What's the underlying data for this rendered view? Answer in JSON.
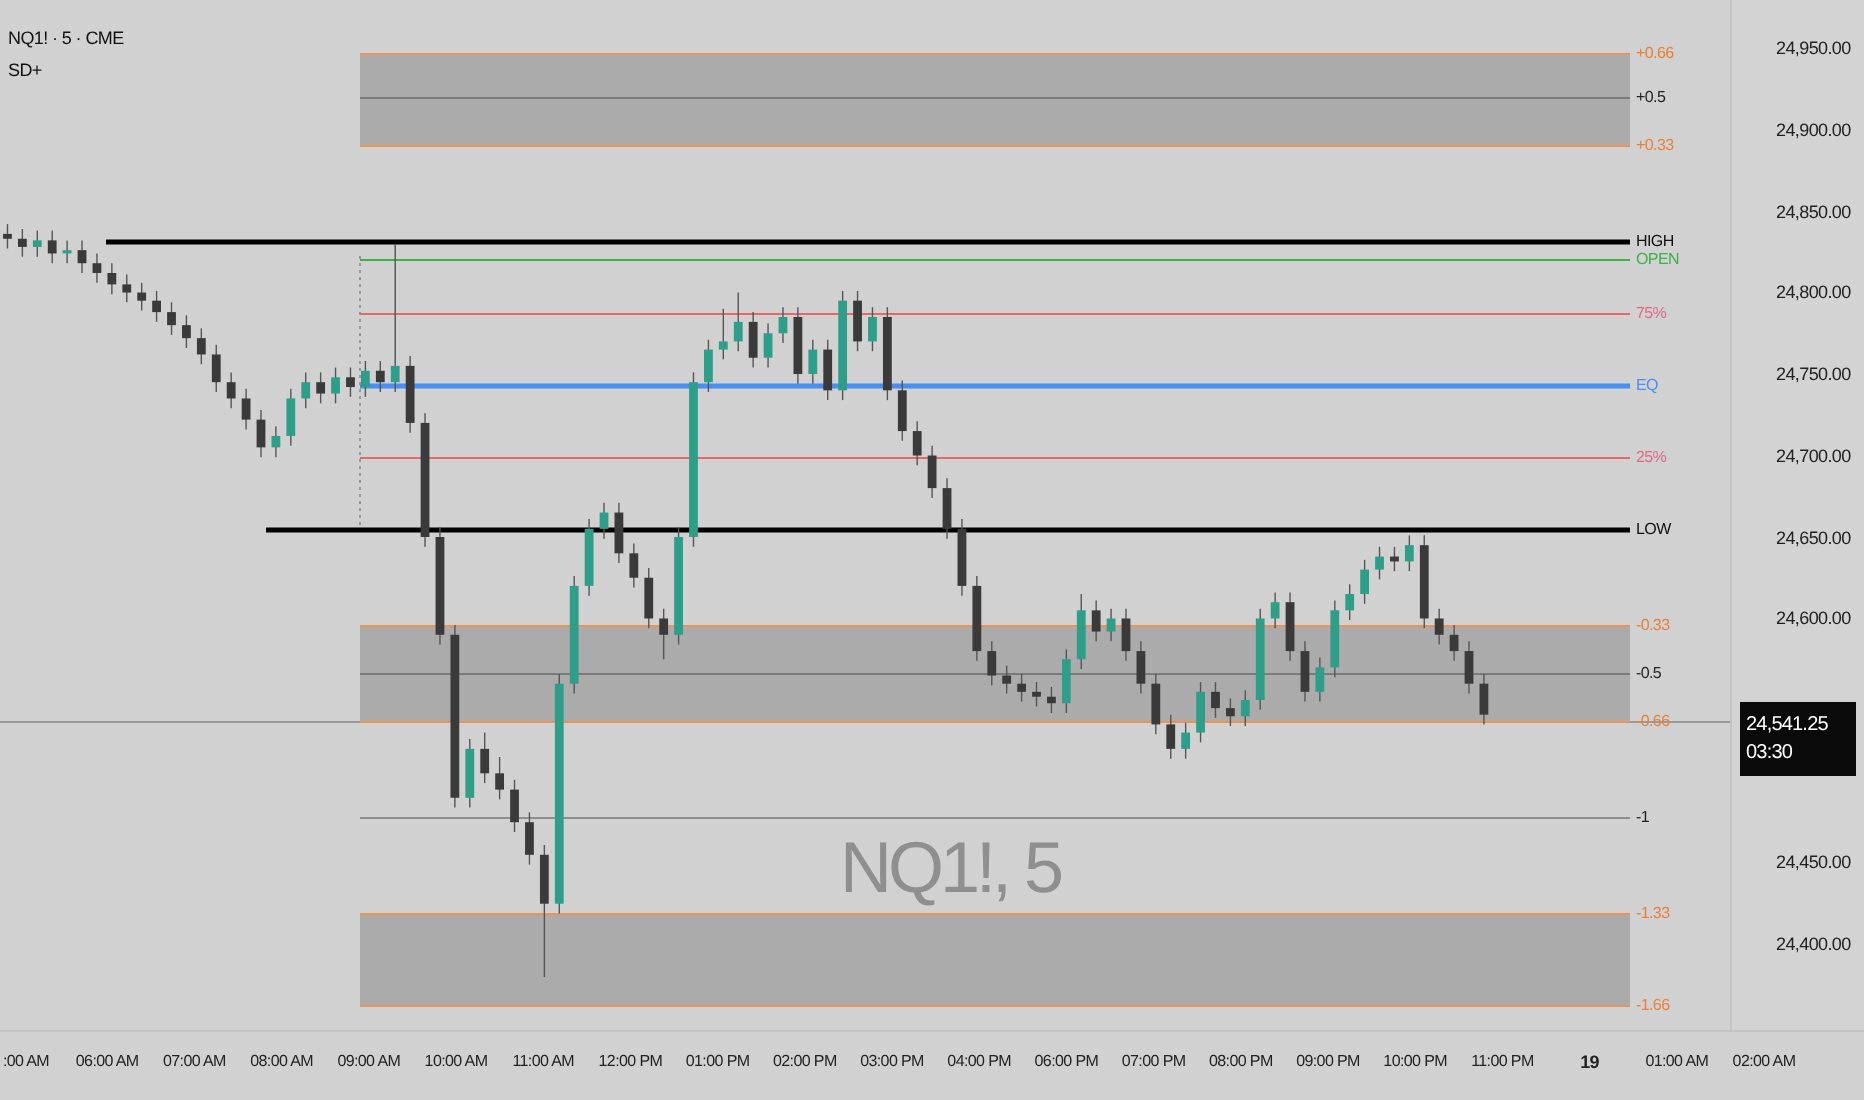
{
  "legend": {
    "symbol": "NQ1! · 5 · CME",
    "indicator": "SD+"
  },
  "symbol_watermark": "NQ1!, 5",
  "chart_data": {
    "type": "candlestick",
    "categories": [
      null,
      null,
      null,
      null,
      null,
      null,
      null,
      null,
      null,
      null,
      null,
      null,
      null,
      null,
      null,
      null,
      null,
      null,
      null,
      null,
      null,
      null,
      null,
      null,
      null,
      null,
      null,
      null,
      null,
      null,
      null,
      null,
      null,
      null,
      null,
      null,
      null,
      null,
      null,
      null,
      null,
      null,
      null,
      null,
      null,
      null,
      null,
      null,
      null,
      null,
      null,
      null,
      null,
      null,
      null,
      null,
      null,
      null,
      null,
      null,
      null,
      null,
      null,
      null,
      null,
      null,
      null,
      null,
      null,
      null,
      null,
      null,
      null,
      null,
      null,
      null,
      null,
      null,
      null,
      null,
      null,
      null,
      null,
      null,
      null,
      null,
      null,
      null,
      null,
      null,
      null,
      null,
      null,
      null,
      null,
      null,
      null,
      null,
      null,
      null,
      null,
      null,
      null,
      null,
      null,
      null,
      null,
      null,
      null,
      null,
      null,
      null,
      null,
      null,
      null,
      null
    ],
    "ylim": [
      24347.5,
      24979.5
    ],
    "yticks": [
      {
        "value": 24950,
        "label": "24,950.00"
      },
      {
        "value": 24900,
        "label": "24,900.00"
      },
      {
        "value": 24850,
        "label": "24,850.00"
      },
      {
        "value": 24800,
        "label": "24,800.00"
      },
      {
        "value": 24750,
        "label": "24,750.00"
      },
      {
        "value": 24700,
        "label": "24,700.00"
      },
      {
        "value": 24650,
        "label": "24,650.00"
      },
      {
        "value": 24600,
        "label": "24,600.00"
      },
      {
        "value": 24450,
        "label": "24,450.00"
      },
      {
        "value": 24400,
        "label": "24,400.00"
      }
    ],
    "ohlc": [
      [
        24836,
        24842,
        24827,
        24833
      ],
      [
        24833,
        24839,
        24822,
        24828
      ],
      [
        24828,
        24838,
        24822,
        24832
      ],
      [
        24832,
        24838,
        24818,
        24824
      ],
      [
        24824,
        24832,
        24818,
        24826
      ],
      [
        24826,
        24832,
        24812,
        24818
      ],
      [
        24818,
        24824,
        24806,
        24812
      ],
      [
        24812,
        24818,
        24799,
        24805
      ],
      [
        24805,
        24811,
        24794,
        24800
      ],
      [
        24800,
        24806,
        24789,
        24795
      ],
      [
        24795,
        24801,
        24782,
        24788
      ],
      [
        24788,
        24794,
        24774,
        24780
      ],
      [
        24780,
        24786,
        24766,
        24772
      ],
      [
        24772,
        24778,
        24756,
        24762
      ],
      [
        24762,
        24768,
        24739,
        24745
      ],
      [
        24745,
        24751,
        24729,
        24735
      ],
      [
        24735,
        24741,
        24716,
        24722
      ],
      [
        24722,
        24728,
        24699,
        24705
      ],
      [
        24705,
        24718,
        24699,
        24712
      ],
      [
        24712,
        24741,
        24706,
        24735
      ],
      [
        24735,
        24751,
        24729,
        24745
      ],
      [
        24745,
        24751,
        24732,
        24738
      ],
      [
        24738,
        24754,
        24732,
        24748
      ],
      [
        24748,
        24754,
        24736,
        24742
      ],
      [
        24742,
        24758,
        24736,
        24752
      ],
      [
        24752,
        24758,
        24739,
        24745
      ],
      [
        24745,
        24830,
        24739,
        24755
      ],
      [
        24755,
        24761,
        24714,
        24720
      ],
      [
        24720,
        24726,
        24644,
        24650
      ],
      [
        24650,
        24656,
        24584,
        24590
      ],
      [
        24590,
        24596,
        24484,
        24490
      ],
      [
        24490,
        24526,
        24484,
        24520
      ],
      [
        24520,
        24530,
        24499,
        24505
      ],
      [
        24505,
        24515,
        24489,
        24495
      ],
      [
        24495,
        24501,
        24469,
        24475
      ],
      [
        24475,
        24481,
        24449,
        24455
      ],
      [
        24455,
        24461,
        24380,
        24425
      ],
      [
        24425,
        24566,
        24419,
        24560
      ],
      [
        24560,
        24626,
        24554,
        24620
      ],
      [
        24620,
        24661,
        24614,
        24655
      ],
      [
        24655,
        24671,
        24649,
        24665
      ],
      [
        24665,
        24671,
        24634,
        24640
      ],
      [
        24640,
        24646,
        24619,
        24625
      ],
      [
        24625,
        24631,
        24594,
        24600
      ],
      [
        24600,
        24606,
        24575,
        24590
      ],
      [
        24590,
        24656,
        24584,
        24650
      ],
      [
        24650,
        24751,
        24644,
        24745
      ],
      [
        24745,
        24771,
        24739,
        24765
      ],
      [
        24765,
        24790,
        24759,
        24770
      ],
      [
        24770,
        24800,
        24764,
        24782
      ],
      [
        24782,
        24788,
        24754,
        24760
      ],
      [
        24760,
        24781,
        24754,
        24775
      ],
      [
        24775,
        24791,
        24769,
        24785
      ],
      [
        24785,
        24791,
        24744,
        24750
      ],
      [
        24750,
        24771,
        24744,
        24765
      ],
      [
        24765,
        24771,
        24734,
        24740
      ],
      [
        24740,
        24801,
        24734,
        24795
      ],
      [
        24795,
        24801,
        24764,
        24770
      ],
      [
        24770,
        24791,
        24764,
        24785
      ],
      [
        24785,
        24791,
        24734,
        24740
      ],
      [
        24740,
        24746,
        24709,
        24715
      ],
      [
        24715,
        24721,
        24694,
        24700
      ],
      [
        24700,
        24706,
        24674,
        24680
      ],
      [
        24680,
        24686,
        24649,
        24655
      ],
      [
        24655,
        24661,
        24614,
        24620
      ],
      [
        24620,
        24626,
        24574,
        24580
      ],
      [
        24580,
        24586,
        24559,
        24565
      ],
      [
        24565,
        24571,
        24554,
        24560
      ],
      [
        24560,
        24566,
        24549,
        24555
      ],
      [
        24555,
        24561,
        24546,
        24552
      ],
      [
        24552,
        24558,
        24542,
        24548
      ],
      [
        24548,
        24581,
        24542,
        24575
      ],
      [
        24575,
        24615,
        24569,
        24605
      ],
      [
        24605,
        24611,
        24586,
        24592
      ],
      [
        24592,
        24606,
        24586,
        24600
      ],
      [
        24600,
        24606,
        24574,
        24580
      ],
      [
        24580,
        24586,
        24554,
        24560
      ],
      [
        24560,
        24566,
        24529,
        24535
      ],
      [
        24535,
        24541,
        24514,
        24520
      ],
      [
        24520,
        24536,
        24514,
        24530
      ],
      [
        24530,
        24561,
        24524,
        24555
      ],
      [
        24555,
        24561,
        24539,
        24545
      ],
      [
        24545,
        24551,
        24534,
        24540
      ],
      [
        24540,
        24556,
        24534,
        24550
      ],
      [
        24550,
        24606,
        24544,
        24600
      ],
      [
        24600,
        24616,
        24594,
        24610
      ],
      [
        24610,
        24616,
        24574,
        24580
      ],
      [
        24580,
        24586,
        24549,
        24555
      ],
      [
        24555,
        24576,
        24549,
        24570
      ],
      [
        24570,
        24611,
        24564,
        24605
      ],
      [
        24605,
        24621,
        24599,
        24615
      ],
      [
        24615,
        24636,
        24609,
        24630
      ],
      [
        24630,
        24644,
        24624,
        24638
      ],
      [
        24638,
        24644,
        24629,
        24635
      ],
      [
        24635,
        24651,
        24629,
        24645
      ],
      [
        24645,
        24651,
        24594,
        24600
      ],
      [
        24600,
        24606,
        24584,
        24590
      ],
      [
        24590,
        24596,
        24574,
        24580
      ],
      [
        24580,
        24586,
        24554,
        24560
      ],
      [
        24560,
        24566,
        24535,
        24541
      ],
      null,
      null,
      null,
      null,
      null,
      null,
      null,
      null,
      null,
      null,
      null,
      null,
      null,
      null,
      null,
      null
    ]
  },
  "levels": [
    {
      "label": "+0.66",
      "kind": "zone_edge"
    },
    {
      "label": "+0.5",
      "kind": "zone_mid"
    },
    {
      "label": "+0.33",
      "kind": "zone_edge"
    },
    {
      "label": "HIGH",
      "kind": "range"
    },
    {
      "label": "OPEN",
      "kind": "open"
    },
    {
      "label": "75%",
      "kind": "quarter"
    },
    {
      "label": "EQ",
      "kind": "equilibrium"
    },
    {
      "label": "25%",
      "kind": "quarter"
    },
    {
      "label": "LOW",
      "kind": "range"
    },
    {
      "label": "-0.33",
      "kind": "zone_edge"
    },
    {
      "label": "-0.5",
      "kind": "zone_mid"
    },
    {
      "label": "-0.66",
      "kind": "zone_edge"
    },
    {
      "label": "-1",
      "kind": "deviation"
    },
    {
      "label": "-1.33",
      "kind": "zone_edge"
    },
    {
      "label": "-1.66",
      "kind": "zone_edge"
    }
  ],
  "price_axis": {
    "last_price": {
      "price": "24,541.25",
      "countdown": "03:30"
    }
  },
  "time_axis": {
    "labels": [
      {
        "text": ":00 AM",
        "kind": "time"
      },
      {
        "text": "06:00 AM",
        "kind": "time"
      },
      {
        "text": "07:00 AM",
        "kind": "time"
      },
      {
        "text": "08:00 AM",
        "kind": "time"
      },
      {
        "text": "09:00 AM",
        "kind": "time"
      },
      {
        "text": "10:00 AM",
        "kind": "time"
      },
      {
        "text": "11:00 AM",
        "kind": "time"
      },
      {
        "text": "12:00 PM",
        "kind": "time"
      },
      {
        "text": "01:00 PM",
        "kind": "time"
      },
      {
        "text": "02:00 PM",
        "kind": "time"
      },
      {
        "text": "03:00 PM",
        "kind": "time"
      },
      {
        "text": "04:00 PM",
        "kind": "time"
      },
      {
        "text": "06:00 PM",
        "kind": "time"
      },
      {
        "text": "07:00 PM",
        "kind": "time"
      },
      {
        "text": "08:00 PM",
        "kind": "time"
      },
      {
        "text": "09:00 PM",
        "kind": "time"
      },
      {
        "text": "10:00 PM",
        "kind": "time"
      },
      {
        "text": "11:00 PM",
        "kind": "time"
      },
      {
        "text": "19",
        "kind": "day"
      },
      {
        "text": "01:00 AM",
        "kind": "time"
      },
      {
        "text": "02:00 AM",
        "kind": "time"
      }
    ]
  }
}
